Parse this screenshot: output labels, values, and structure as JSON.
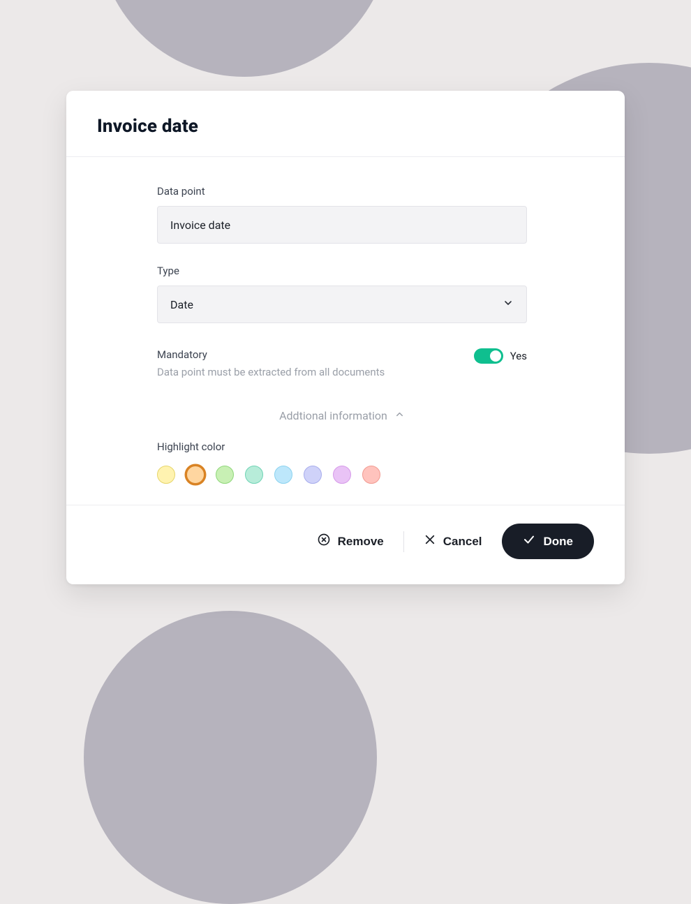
{
  "modal": {
    "title": "Invoice date",
    "data_point": {
      "label": "Data point",
      "value": "Invoice date"
    },
    "type": {
      "label": "Type",
      "value": "Date"
    },
    "mandatory": {
      "label": "Mandatory",
      "description": "Data point must be extracted from all documents",
      "state_label": "Yes",
      "on": true
    },
    "additional_label": "Addtional information",
    "highlight": {
      "label": "Highlight color",
      "colors": [
        {
          "name": "yellow",
          "fill": "#fff3b0",
          "border": "#e6d56a",
          "selected": false
        },
        {
          "name": "orange",
          "fill": "#ffd6a0",
          "border": "#d98324",
          "selected": true
        },
        {
          "name": "green",
          "fill": "#c8f0b4",
          "border": "#8fd77a",
          "selected": false
        },
        {
          "name": "teal",
          "fill": "#b7ecd9",
          "border": "#6fd3b5",
          "selected": false
        },
        {
          "name": "blue",
          "fill": "#bde7fb",
          "border": "#8bd2ef",
          "selected": false
        },
        {
          "name": "indigo",
          "fill": "#cfd2f9",
          "border": "#a7acec",
          "selected": false
        },
        {
          "name": "purple",
          "fill": "#e9c3f6",
          "border": "#d69ae9",
          "selected": false
        },
        {
          "name": "red",
          "fill": "#ffc3bd",
          "border": "#f19a91",
          "selected": false
        }
      ]
    },
    "actions": {
      "remove": "Remove",
      "cancel": "Cancel",
      "done": "Done"
    }
  }
}
